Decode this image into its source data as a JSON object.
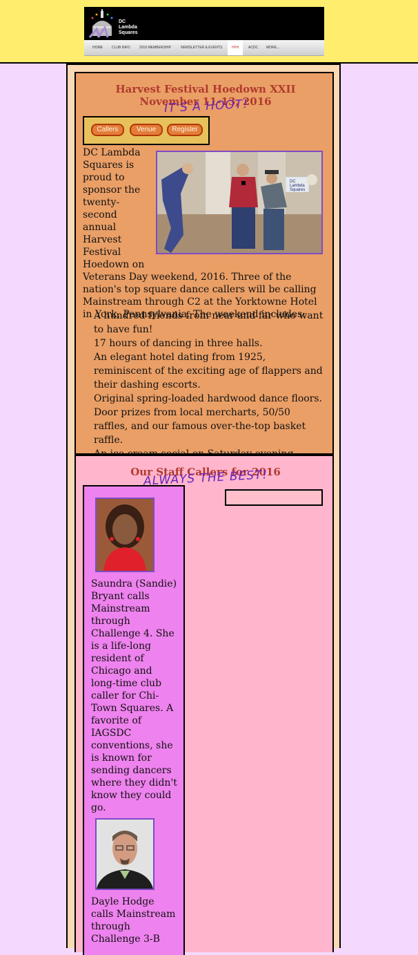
{
  "logo": {
    "line1": "DC",
    "line2": "Lambda",
    "line3": "Squares",
    "icon": "capitol-dancers-logo"
  },
  "nav": {
    "items": [
      "HOME",
      "CLUB INFO",
      "2016 MEMBERSHIP",
      "NEWSLETTER & EVENTS",
      "HFH",
      "ACDC",
      "MORE..."
    ],
    "active": "HFH"
  },
  "hoedown": {
    "title": "Harvest Festival Hoedown XXII",
    "dates": "November 11-13, 2016",
    "tagline": "IT'S A HOOT!",
    "buttons": [
      "Callers",
      "Venue",
      "Register"
    ],
    "intro_lead": "DC Lambda Squares is proud to sponsor the twenty-second annual Harvest Festival Hoedown on",
    "intro_rest": "Veterans Day weekend, 2016. Three of the nation's top square dance callers will be calling Mainstream through C2 at the Yorktowne Hotel in York, Pennsylvania. The weekend includes:",
    "bullets": [
      "A hundred friends from near and far who want to have fun!",
      "17 hours of dancing in three halls.",
      "An elegant hotel dating from 1925, reminiscent of the exciting age of flappers and their dashing escorts.",
      "Original spring-loaded hardwood dance floors.",
      "Door prizes from local mercharts, 50/50 raffles, and our famous over-the-top basket raffle.",
      "An ice cream social on Saturday evening."
    ],
    "photo_sign": "DC Lambda Squares"
  },
  "callers": {
    "title": "Our Staff Callers for 2016",
    "tagline": "ALWAYS THE BEST!",
    "list": [
      {
        "bio": "Saundra (Sandie) Bryant calls Mainstream through Challenge 4. She is a life-long resident of Chicago and long-time club caller for Chi-Town Squares. A favorite of IAGSDC conventions, she is known for sending dancers where they didn't know they could go."
      },
      {
        "bio": "Dayle Hodge calls Mainstream through Challenge 3-B"
      }
    ]
  },
  "colors": {
    "header_bg": "#ffee6e",
    "page_bg": "#f5d9fd",
    "hoedown_bg": "#ea9f66",
    "callers_bg": "#ffb5cc",
    "title_red": "#b03a2e",
    "accent_purple": "#6a22b8"
  }
}
